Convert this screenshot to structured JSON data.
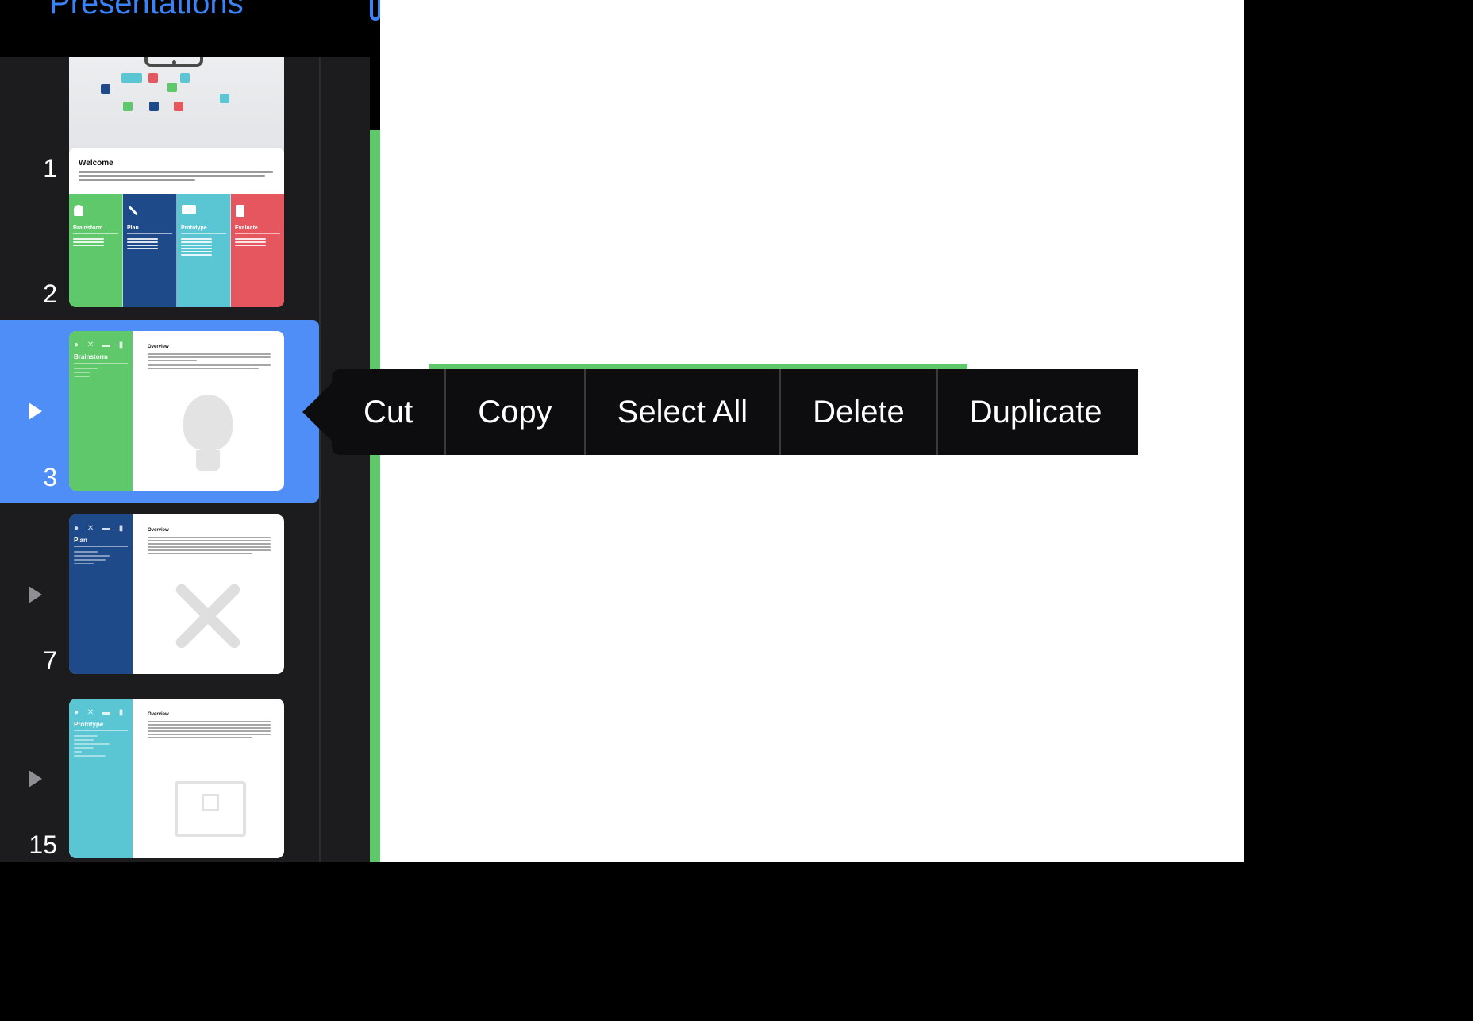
{
  "header": {
    "back_label": "Presentations"
  },
  "slides": [
    {
      "number": "1"
    },
    {
      "number": "2",
      "title": "Welcome",
      "columns": [
        "Brainstorm",
        "Plan",
        "Prototype",
        "Evaluate"
      ]
    },
    {
      "number": "3",
      "side_title": "Brainstorm",
      "overview_title": "Overview",
      "selected": true
    },
    {
      "number": "7",
      "side_title": "Plan",
      "overview_title": "Overview"
    },
    {
      "number": "15",
      "side_title": "Prototype",
      "overview_title": "Overview"
    }
  ],
  "context_menu": {
    "items": [
      "Cut",
      "Copy",
      "Select All",
      "Delete",
      "Duplicate"
    ]
  },
  "colors": {
    "accent": "#3a82f7",
    "selection": "#4f8ef7",
    "brainstorm": "#5ec86a",
    "plan": "#1e4a8a",
    "prototype": "#5bc6d3",
    "evaluate": "#e5565f"
  }
}
